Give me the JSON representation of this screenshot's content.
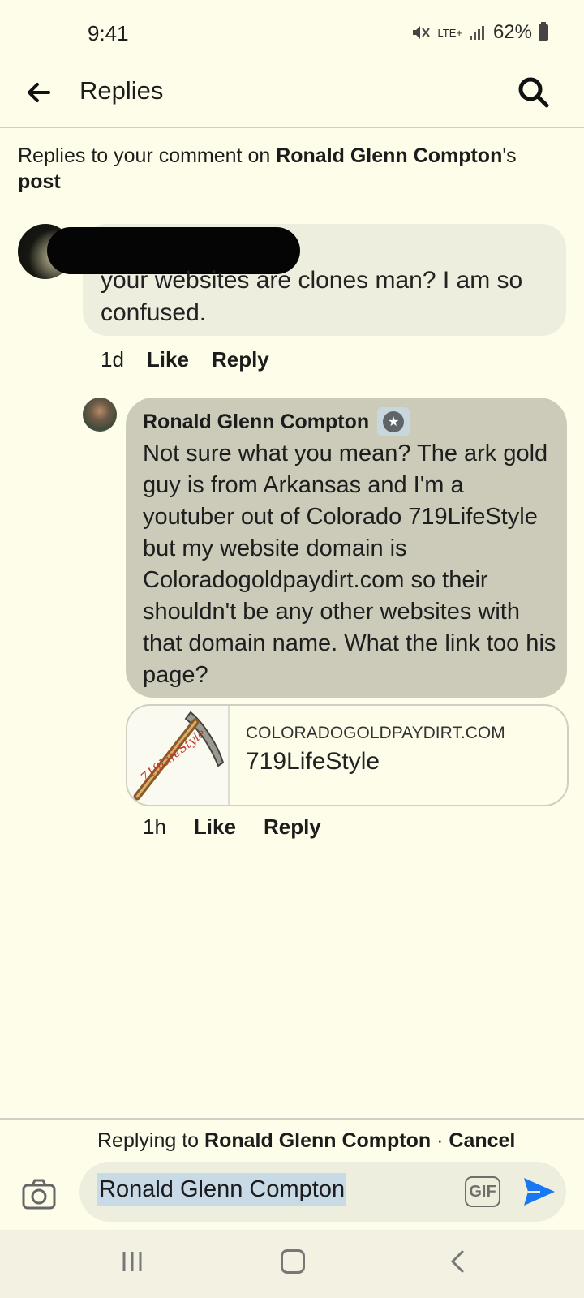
{
  "status_bar": {
    "time": "9:41",
    "network": "LTE+",
    "battery": "62%"
  },
  "header": {
    "title": "Replies"
  },
  "intro": {
    "prefix": "Replies to your comment on ",
    "author": "Ronald Glenn Compton",
    "possessive": "'s",
    "post_word": "post"
  },
  "comment1": {
    "text": "your websites are clones man?  I am so confused.",
    "time": "1d",
    "like": "Like",
    "reply": "Reply"
  },
  "comment2": {
    "author": "Ronald Glenn Compton",
    "text": "Not sure what you mean? The ark gold guy is from Arkansas and I'm a youtuber out of Colorado 719LifeStyle but my website domain is Coloradogoldpaydirt.com so their shouldn't be any other websites with that domain name. What the link too his page?",
    "link": {
      "domain": "COLORADOGOLDPAYDIRT.COM",
      "title": "719LifeStyle",
      "thumb_text": "719LifeStyle"
    },
    "time": "1h",
    "like": "Like",
    "reply": "Reply"
  },
  "reply_bar": {
    "prefix": "Replying to ",
    "name": "Ronald Glenn Compton",
    "separator": " · ",
    "cancel": "Cancel",
    "input_value": "Ronald Glenn Compton",
    "gif_label": "GIF"
  },
  "colors": {
    "background": "#fefde9",
    "send": "#1877f2",
    "bubble": "#cccbba"
  }
}
